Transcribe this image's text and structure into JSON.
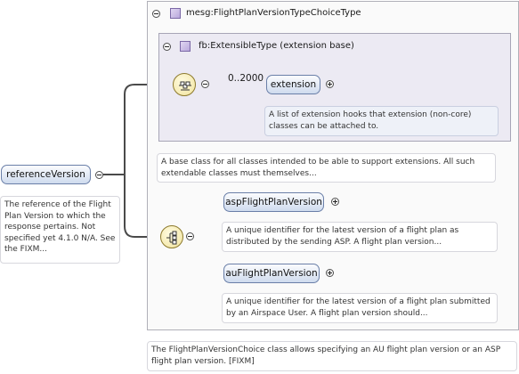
{
  "root_element": {
    "name": "referenceVersion",
    "doc": "The reference of the Flight Plan Version to which the response pertains. Not specified yet 4.1.0 N/A. See the FIXM..."
  },
  "choice_type": {
    "name": "mesg:FlightPlanVersionTypeChoiceType",
    "doc": "The FlightPlanVersionChoice class allows specifying an AU flight plan version or an ASP flight plan version. [FIXM]"
  },
  "extensible_type": {
    "name": "fb:ExtensibleType (extension base)",
    "doc": "A base class for all classes intended to be able to support extensions. All such extendable classes must themselves..."
  },
  "extension": {
    "cardinality": "0..2000",
    "name": "extension",
    "doc": "A list of extension hooks that extension (non-core) classes can be attached to."
  },
  "choices": [
    {
      "name": "aspFlightPlanVersion",
      "doc": "A unique identifier for the latest version of a flight plan as distributed by the sending ASP. A flight plan version..."
    },
    {
      "name": "auFlightPlanVersion",
      "doc": "A unique identifier for the latest version of a flight plan submitted by an Airspace User. A flight plan version should..."
    }
  ],
  "colors": {
    "element_fill": "#cfdbee",
    "element_border": "#6a7fa8",
    "compositor_fill": "#f1e39c",
    "connector": "#4a4a4a"
  }
}
